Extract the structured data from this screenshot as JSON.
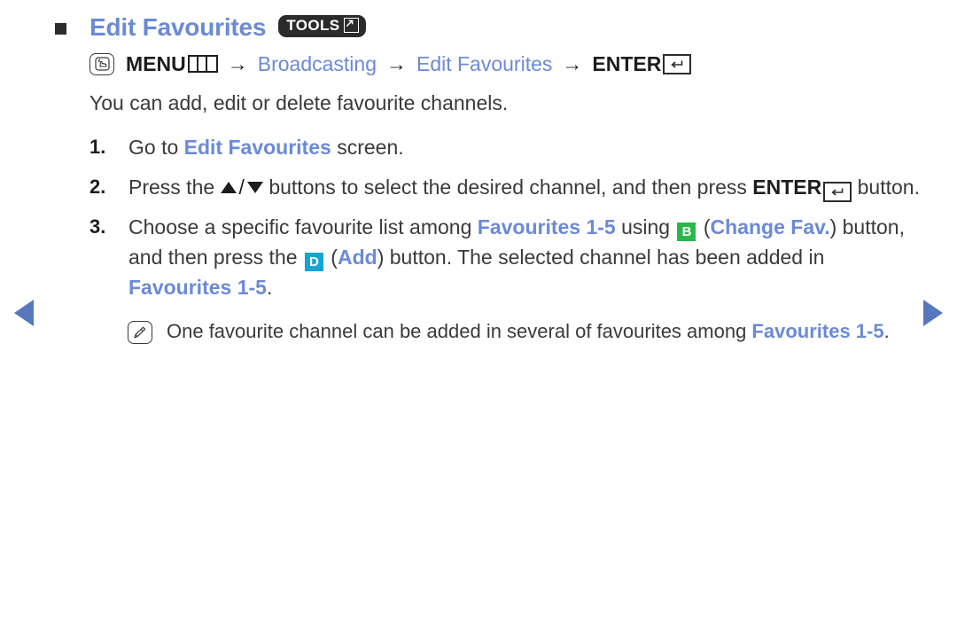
{
  "page": {
    "heading": {
      "bullet": "square-bullet",
      "title": "Edit Favourites",
      "badge_label": "TOOLS",
      "badge_icon": "tools-arrow-icon"
    },
    "menu_path": {
      "key_icon": "menu-hand-key-icon",
      "menu_label": "MENU",
      "menu_icon": "menu-bars-icon",
      "separator": "→",
      "step1": "Broadcasting",
      "step2": "Edit Favourites",
      "enter_label": "ENTER",
      "enter_icon": "enter-return-icon"
    },
    "intro": "You can add, edit or delete favourite channels.",
    "steps": [
      {
        "number": "1.",
        "segments": [
          {
            "text": "Go to ",
            "style": "plain"
          },
          {
            "text": "Edit Favourites",
            "style": "blue-bold"
          },
          {
            "text": " screen.",
            "style": "plain"
          }
        ]
      },
      {
        "number": "2.",
        "segments": [
          {
            "text": "Press the ",
            "style": "plain"
          },
          {
            "text": "▲",
            "style": "icon-up"
          },
          {
            "text": "/",
            "style": "slash"
          },
          {
            "text": "▼",
            "style": "icon-down"
          },
          {
            "text": " buttons to select the desired channel, and then press ",
            "style": "plain"
          },
          {
            "text": "ENTER",
            "style": "bold"
          },
          {
            "text": "enter-return-icon",
            "style": "enter-box"
          },
          {
            "text": " button.",
            "style": "plain"
          }
        ]
      },
      {
        "number": "3.",
        "segments": [
          {
            "text": "Choose a specific favourite list among ",
            "style": "plain"
          },
          {
            "text": "Favourites 1-5",
            "style": "blue-bold"
          },
          {
            "text": " using ",
            "style": "plain"
          },
          {
            "text": "B",
            "style": "key-green"
          },
          {
            "text": " (",
            "style": "plain"
          },
          {
            "text": "Change Fav.",
            "style": "blue-bold"
          },
          {
            "text": ") button, and then press the ",
            "style": "plain"
          },
          {
            "text": "D",
            "style": "key-cyan"
          },
          {
            "text": " (",
            "style": "plain"
          },
          {
            "text": "Add",
            "style": "blue-bold"
          },
          {
            "text": ") button. The selected channel has been added in ",
            "style": "plain"
          },
          {
            "text": "Favourites 1-5",
            "style": "blue-bold"
          },
          {
            "text": ".",
            "style": "plain"
          }
        ]
      }
    ],
    "note": {
      "icon": "note-pencil-icon",
      "segments": [
        {
          "text": "One favourite channel can be added in several of favourites among ",
          "style": "plain"
        },
        {
          "text": "Favourites 1-5",
          "style": "blue-bold"
        },
        {
          "text": ".",
          "style": "plain"
        }
      ]
    },
    "nav": {
      "prev_icon": "previous-page-arrow-icon",
      "next_icon": "next-page-arrow-icon"
    },
    "colors": {
      "accent_blue": "#6b8ad6",
      "key_b_green": "#2ab74a",
      "key_d_cyan": "#14a5d4",
      "body_text": "#3a3a3c",
      "nav_arrow": "#5977bd"
    }
  }
}
